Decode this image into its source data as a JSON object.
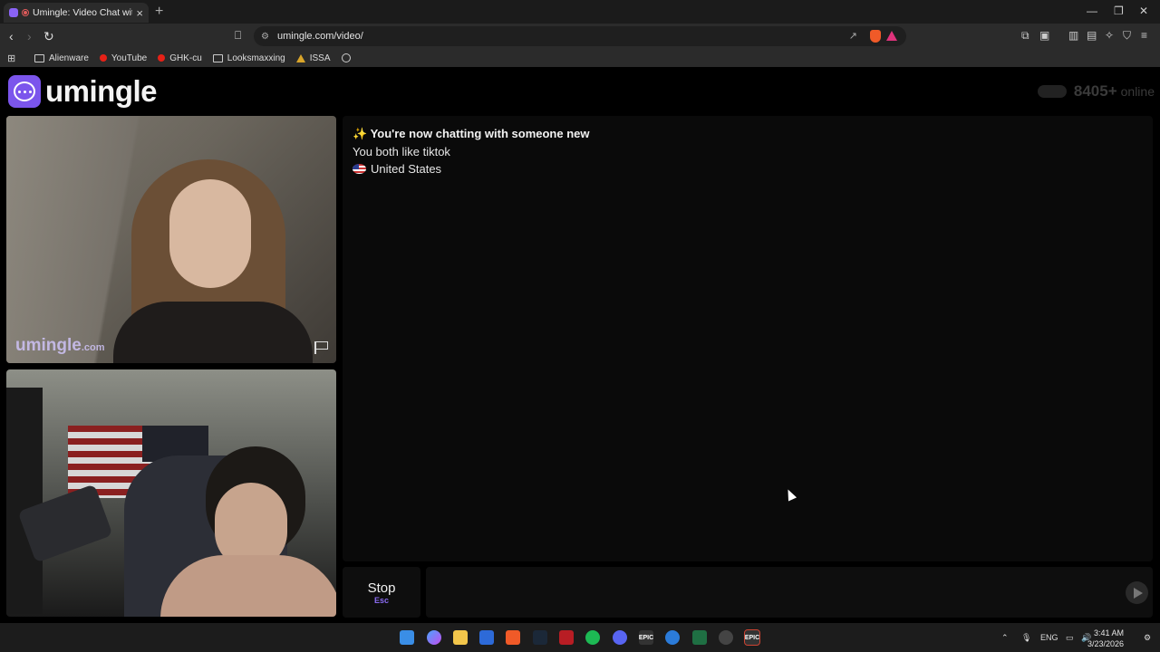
{
  "browser": {
    "tab_title": "Umingle: Video Chat with Stra",
    "url": "umingle.com/video/",
    "bookmarks": [
      "Alienware",
      "YouTube",
      "GHK-cu",
      "Looksmaxxing",
      "ISSA"
    ]
  },
  "site": {
    "logo_text": "umingle",
    "online_count": "8405+",
    "online_label": "online",
    "watermark": "umingle",
    "watermark_suffix": ".com"
  },
  "chat": {
    "new_partner": "✨ You're now chatting with someone new",
    "interest": "You both like tiktok",
    "country": "United States"
  },
  "controls": {
    "stop_label": "Stop",
    "stop_shortcut": "Esc",
    "message_value": ""
  },
  "taskbar": {
    "language": "ENG",
    "time": "3:41 AM",
    "date": "3/23/2026"
  },
  "colors": {
    "brand": "#7b55ec",
    "background": "#000000",
    "panel": "#0a0a0a"
  }
}
